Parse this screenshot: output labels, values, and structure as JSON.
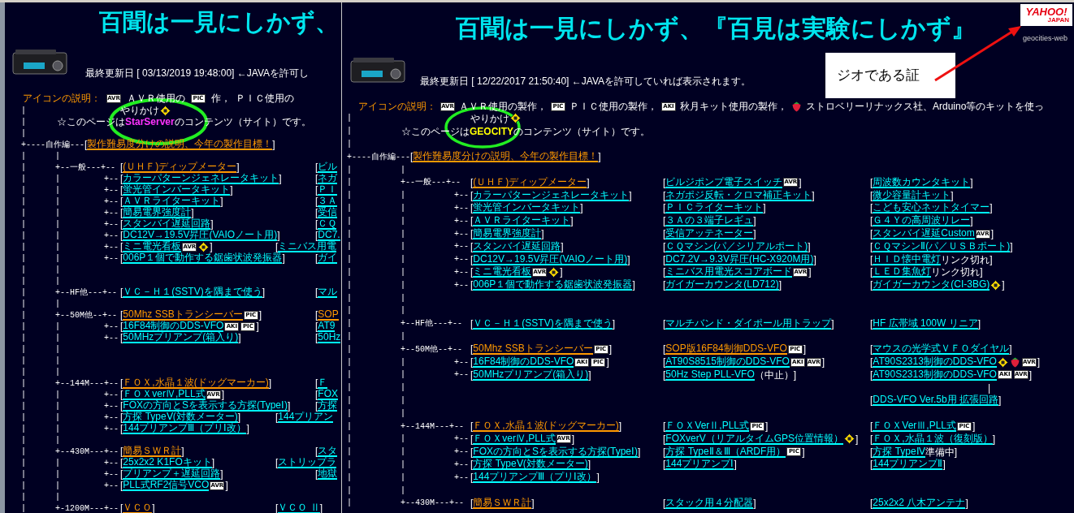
{
  "windows": [
    {
      "title": "百聞は一見にしかず、",
      "updated": "最終更新日 [ 03/13/2019 19:48:00] ←JAVAを許可し",
      "legend": [
        {
          "kind": "label",
          "text": "アイコンの説明："
        },
        {
          "kind": "chip",
          "text": "AVR"
        },
        {
          "kind": "text",
          "text": "ＡＶＲ使用の"
        },
        {
          "kind": "chip",
          "text": "PIC"
        },
        {
          "kind": "text",
          "text": "作，"
        },
        {
          "kind": "text",
          "text": "ＰＩＣ使用の"
        }
      ],
      "rows": [
        {
          "kind": "branch",
          "tree": "|",
          "cells": [
            {
              "text": "やりかけ",
              "icons": [
                {
                  "kind": "diamond"
                }
              ]
            }
          ]
        },
        {
          "kind": "note",
          "tree": "|",
          "text": "☆このページは**StarServer**のコンテンツ（サイト）です。",
          "color": "#ff33ff"
        },
        {
          "kind": "blank",
          "tree": "|"
        },
        {
          "kind": "section",
          "tree": "+----自作編---",
          "cells": [
            {
              "open": "[",
              "link": "製作難易度分けの説明、今年の製作目標！",
              "color": "#ff9900",
              "close": "]"
            }
          ]
        },
        {
          "kind": "blank",
          "tree": "|      |"
        },
        {
          "kind": "branch",
          "tree": "|      +--一般---+--",
          "cells": [
            {
              "open": "[",
              "link": "(ＵＨＦ)ディップメーター",
              "color": "#ff9900",
              "close": "]"
            },
            {
              "open": "[",
              "link": "ビル",
              "color": "#00ffff"
            }
          ]
        },
        {
          "kind": "branch",
          "tree": "|      |         +--",
          "cells": [
            {
              "open": "[",
              "link": "カラーパターンジェネレータキット",
              "color": "#00ffff",
              "close": "]"
            },
            {
              "open": "[",
              "link": "ネガ",
              "color": "#00ffff"
            }
          ]
        },
        {
          "kind": "branch",
          "tree": "|      |         +--",
          "cells": [
            {
              "open": "[",
              "link": "蛍光管インバータキット",
              "color": "#00ffff",
              "close": "]"
            },
            {
              "open": "[",
              "link": "ＰＩ",
              "color": "#00ffff"
            }
          ]
        },
        {
          "kind": "branch",
          "tree": "|      |         +--",
          "cells": [
            {
              "open": "[",
              "link": "ＡＶＲライターキット",
              "color": "#00ffff",
              "close": "]"
            },
            {
              "open": "[",
              "link": "３Ａ",
              "color": "#00ffff"
            }
          ]
        },
        {
          "kind": "branch",
          "tree": "|      |         +--",
          "cells": [
            {
              "open": "[",
              "link": "簡易電界強度計",
              "color": "#00ffff",
              "close": "]"
            },
            {
              "open": "[",
              "link": "受信",
              "color": "#00ffff"
            }
          ]
        },
        {
          "kind": "branch",
          "tree": "|      |         +--",
          "cells": [
            {
              "open": "[",
              "link": "スタンバイ遅延回路",
              "color": "#00ffff",
              "close": "]"
            },
            {
              "open": "[",
              "link": "ＣＱ",
              "color": "#00ffff"
            }
          ]
        },
        {
          "kind": "branch",
          "tree": "|      |         +--",
          "cells": [
            {
              "open": "[",
              "link": "DC12V→19.5V昇圧(VAIOノート用)",
              "color": "#00ffff",
              "close": "]"
            },
            {
              "open": "[",
              "link": "DC7.",
              "color": "#00ffff"
            }
          ]
        },
        {
          "kind": "loose",
          "tree": "|      |         +--",
          "cells": [
            {
              "open": "[",
              "link": "ミニ電光看板",
              "color": "#00ffff",
              "icons": [
                {
                  "kind": "chip",
                  "text": "AVR"
                },
                {
                  "kind": "diamond"
                }
              ],
              "close": "]"
            },
            {
              "open": "[",
              "link": "ミニバス用電",
              "color": "#00ffff"
            }
          ]
        },
        {
          "kind": "branch",
          "tree": "|      |         +--",
          "cells": [
            {
              "open": "[",
              "link": "006P１個で動作する鋸歯状波発振器",
              "color": "#00ffff",
              "close": "]"
            },
            {
              "open": "[",
              "link": "ガイ",
              "color": "#00ffff"
            }
          ]
        },
        {
          "kind": "blank",
          "tree": "|      |"
        },
        {
          "kind": "blank",
          "tree": "|      |"
        },
        {
          "kind": "branch",
          "tree": "|      +--HF他---+--",
          "cells": [
            {
              "open": "[",
              "link": "ＶＣ－Ｈ１(SSTV)を隅まで使う",
              "color": "#00ffff",
              "close": "]"
            },
            {
              "open": "[",
              "link": "マル",
              "color": "#00ffff"
            }
          ]
        },
        {
          "kind": "blank",
          "tree": "|      |"
        },
        {
          "kind": "branch",
          "tree": "|      +--50M他--+--",
          "cells": [
            {
              "open": "[",
              "link": "50Mhz SSBトランシーバー",
              "color": "#ff9900",
              "icons": [
                {
                  "kind": "chip",
                  "text": "PIC"
                }
              ],
              "close": "]"
            },
            {
              "open": "[",
              "link": "SOP",
              "color": "#ff9900"
            }
          ]
        },
        {
          "kind": "branch",
          "tree": "|      |         +--",
          "cells": [
            {
              "open": "[",
              "link": "16F84制御のDDS-VFO",
              "color": "#00ffff",
              "icons": [
                {
                  "kind": "chip",
                  "text": "AKI"
                },
                {
                  "kind": "chip",
                  "text": "PIC"
                }
              ],
              "close": "]"
            },
            {
              "open": "[",
              "link": "AT9",
              "color": "#00ffff"
            }
          ]
        },
        {
          "kind": "branch",
          "tree": "|      |         +--",
          "cells": [
            {
              "open": "[",
              "link": "50MHzプリアンプ(箱入り)",
              "color": "#00ffff",
              "close": "]"
            },
            {
              "open": "[",
              "link": "50Hz",
              "color": "#00ffff"
            }
          ]
        },
        {
          "kind": "blank",
          "tree": "|      |"
        },
        {
          "kind": "blank",
          "tree": "|      |"
        },
        {
          "kind": "blank",
          "tree": "|      |"
        },
        {
          "kind": "branch",
          "tree": "|      +--144M---+--",
          "cells": [
            {
              "open": "[",
              "link": "ＦＯＸ,水晶１波(ドッグマーカー)",
              "color": "#ff9900",
              "close": "]"
            },
            {
              "open": "[",
              "link": "Ｆ",
              "color": "#00ffff"
            }
          ]
        },
        {
          "kind": "branch",
          "tree": "|      |         +--",
          "cells": [
            {
              "open": "[",
              "link": "ＦＯＸverⅣ,PLL式",
              "color": "#00ffff",
              "icons": [
                {
                  "kind": "chip",
                  "text": "AVR"
                }
              ],
              "close": "]"
            },
            {
              "open": "[",
              "link": "FOX",
              "color": "#00ffff"
            }
          ]
        },
        {
          "kind": "branch",
          "tree": "|      |         +--",
          "cells": [
            {
              "open": "[",
              "link": "FOXの方向とSを表示する方探(TypeⅠ)",
              "color": "#00ffff",
              "close": "]"
            },
            {
              "open": "[",
              "link": "方探",
              "color": "#00ffff"
            }
          ]
        },
        {
          "kind": "loose",
          "tree": "|      |         +--",
          "cells": [
            {
              "open": "[",
              "link": "方探 TypeⅤ(対数メーター)",
              "color": "#00ffff",
              "close": "]"
            },
            {
              "open": "[",
              "link": "144プリアン",
              "color": "#00ffff"
            }
          ]
        },
        {
          "kind": "branch",
          "tree": "|      |         +--",
          "cells": [
            {
              "open": "[",
              "link": "144プリアンプⅢ（プリⅠ改）",
              "color": "#00ffff",
              "close": "]"
            }
          ]
        },
        {
          "kind": "blank",
          "tree": "|      |"
        },
        {
          "kind": "branch",
          "tree": "|      +--430M---+--",
          "cells": [
            {
              "open": "[",
              "link": "簡易ＳＷＲ計",
              "color": "#ff9900",
              "close": "]"
            },
            {
              "open": "[",
              "link": "スタ",
              "color": "#00ffff"
            }
          ]
        },
        {
          "kind": "loose",
          "tree": "|      |         +--",
          "cells": [
            {
              "open": "[",
              "link": "25x2x2 K1FOキット",
              "color": "#00ffff",
              "close": "]"
            },
            {
              "open": "[",
              "link": "ストリップラ",
              "color": "#00ffff"
            }
          ]
        },
        {
          "kind": "branch",
          "tree": "|      |         +--",
          "cells": [
            {
              "open": "[",
              "link": "プリアンプ＋遅延回路",
              "color": "#00ffff",
              "close": "]"
            },
            {
              "open": "[",
              "link": "地獄",
              "color": "#00ffff"
            }
          ]
        },
        {
          "kind": "branch",
          "tree": "|      |         +--",
          "cells": [
            {
              "open": "[",
              "link": "PLL式RF2信号VCO",
              "color": "#00ffff",
              "icons": [
                {
                  "kind": "chip",
                  "text": "AVR"
                }
              ],
              "close": "]"
            }
          ]
        },
        {
          "kind": "blank",
          "tree": "|      |"
        },
        {
          "kind": "loose",
          "tree": "|      +-1200M---+--",
          "cells": [
            {
              "open": "[",
              "link": "ＶＣＯ",
              "color": "#ff9900",
              "close": "]"
            },
            {
              "open": "[",
              "link": "ＶＣＯ Ⅱ",
              "color": "#00ffff",
              "close": "]"
            }
          ]
        }
      ]
    },
    {
      "title": "百聞は一見にしかず、『百見は実験にしかず』",
      "updated": "最終更新日 [ 12/22/2017 21:50:40] ←JAVAを許可していれば表示されます。",
      "logo": {
        "text": "YAHOO!",
        "subtext": "JAPAN",
        "caption": "geocities-web"
      },
      "callout": {
        "text": "ジオである証"
      },
      "legend": [
        {
          "kind": "label",
          "text": "アイコンの説明："
        },
        {
          "kind": "chip",
          "text": "AVR"
        },
        {
          "kind": "text",
          "text": "ＡＶＲ使用の製作，"
        },
        {
          "kind": "chip",
          "text": "PIC"
        },
        {
          "kind": "text",
          "text": "ＰＩＣ使用の製作，"
        },
        {
          "kind": "chip",
          "text": "AKI"
        },
        {
          "kind": "text",
          "text": "秋月キット使用の製作，"
        },
        {
          "kind": "strawberry"
        },
        {
          "kind": "text",
          "text": "ストロベリーリナックス社、Arduino等のキットを使っ"
        }
      ],
      "rows": [
        {
          "kind": "branch",
          "tree": "|",
          "cells": [
            {
              "text": "やりかけ",
              "icons": [
                {
                  "kind": "diamond"
                }
              ]
            }
          ]
        },
        {
          "kind": "note",
          "tree": "|",
          "text": "☆このページは**GEOCITY**のコンテンツ（サイト）です。",
          "color": "#ffff00"
        },
        {
          "kind": "blank",
          "tree": "|"
        },
        {
          "kind": "section",
          "tree": "+----自作編---",
          "cells": [
            {
              "open": "[",
              "link": "製作難易度分けの説明、今年の製作目標！",
              "color": "#ff9900",
              "close": "]"
            }
          ]
        },
        {
          "kind": "blank",
          "tree": "|          |"
        },
        {
          "kind": "branch",
          "tree": "|          +--一般---+--",
          "cells": [
            {
              "open": "[",
              "link": "(ＵＨＦ)ディップメーター",
              "color": "#ff9900",
              "close": "]"
            },
            {
              "open": "[",
              "link": "ビルジポンプ電子スイッチ",
              "color": "#00ffff",
              "icons": [
                {
                  "kind": "chip",
                  "text": "AVR"
                }
              ],
              "close": "]"
            },
            {
              "open": "[",
              "link": "周波数カウンタキット",
              "color": "#00ffff",
              "close": "]"
            }
          ]
        },
        {
          "kind": "branch",
          "tree": "|          |          +--",
          "cells": [
            {
              "open": "[",
              "link": "カラーパターンジェネレータキット",
              "color": "#00ffff",
              "close": "]"
            },
            {
              "open": "[",
              "link": "ネガポジ反転・クロマ補正キット",
              "color": "#00ffff",
              "close": "]"
            },
            {
              "open": "[",
              "link": "微少容量計キット",
              "color": "#00ffff",
              "close": "]"
            }
          ]
        },
        {
          "kind": "branch",
          "tree": "|          |          +--",
          "cells": [
            {
              "open": "[",
              "link": "蛍光管インバータキット",
              "color": "#00ffff",
              "close": "]"
            },
            {
              "open": "[",
              "link": "ＰＩＣライターキット",
              "color": "#00ffff",
              "close": "]"
            },
            {
              "open": "[",
              "link": "こども安心ネットタイマー",
              "color": "#00ffff",
              "close": "]"
            }
          ]
        },
        {
          "kind": "branch",
          "tree": "|          |          +--",
          "cells": [
            {
              "open": "[",
              "link": "ＡＶＲライターキット",
              "color": "#00ffff",
              "close": "]"
            },
            {
              "open": "[",
              "link": "３Ａの３端子レギュ",
              "color": "#00ffff",
              "close": "]"
            },
            {
              "open": "[",
              "link": "Ｇ４Ｙの高周波リレー",
              "color": "#00ffff",
              "close": "]"
            }
          ]
        },
        {
          "kind": "branch",
          "tree": "|          |          +--",
          "cells": [
            {
              "open": "[",
              "link": "簡易電界強度計",
              "color": "#00ffff",
              "close": "]"
            },
            {
              "open": "[",
              "link": "受信アッテネーター",
              "color": "#00ffff",
              "close": "]"
            },
            {
              "open": "[",
              "link": "スタンバイ遅延Custom",
              "color": "#00ffff",
              "icons": [
                {
                  "kind": "chip",
                  "text": "AVR"
                }
              ],
              "close": "]"
            }
          ]
        },
        {
          "kind": "branch",
          "tree": "|          |          +--",
          "cells": [
            {
              "open": "[",
              "link": "スタンバイ遅延回路",
              "color": "#00ffff",
              "close": "]"
            },
            {
              "open": "[",
              "link": "ＣＱマシン(パ／シリアルポート)",
              "color": "#00ffff",
              "close": "]"
            },
            {
              "open": "[",
              "link": "ＣＱマシンⅡ(パ／ＵＳＢポート)",
              "color": "#00ffff",
              "close": "]"
            }
          ]
        },
        {
          "kind": "branch",
          "tree": "|          |          +--",
          "cells": [
            {
              "open": "[",
              "link": "DC12V→19.5V昇圧(VAIOノート用)",
              "color": "#00ffff",
              "close": "]"
            },
            {
              "open": "[",
              "link": "DC7.2V→9.3V昇圧(HC-X920M用)",
              "color": "#00ffff",
              "close": "]"
            },
            {
              "open": "[",
              "link": "ＨＩＤ懐中電灯",
              "color": "#00ffff",
              "note": "リンク切れ",
              "close": "]"
            }
          ]
        },
        {
          "kind": "branch",
          "tree": "|          |          +--",
          "cells": [
            {
              "open": "[",
              "link": "ミニ電光看板",
              "color": "#00ffff",
              "icons": [
                {
                  "kind": "chip",
                  "text": "AVR"
                },
                {
                  "kind": "diamond"
                }
              ],
              "close": "]"
            },
            {
              "open": "[",
              "link": "ミニバス用電光スコアボード",
              "color": "#00ffff",
              "icons": [
                {
                  "kind": "chip",
                  "text": "AVR"
                }
              ],
              "close": "]"
            },
            {
              "open": "[",
              "link": "ＬＥＤ集魚灯",
              "color": "#00ffff",
              "note": "リンク切れ",
              "close": "]"
            }
          ]
        },
        {
          "kind": "branch",
          "tree": "|          |          +--",
          "cells": [
            {
              "open": "[",
              "link": "006P１個で動作する鋸歯状波発振器",
              "color": "#00ffff",
              "close": "]"
            },
            {
              "open": "[",
              "link": "ガイガーカウンタ(LD712)",
              "color": "#00ffff",
              "close": "]"
            },
            {
              "open": "[",
              "link": "ガイガーカウンタ(CI-3BG)",
              "color": "#00ffff",
              "icons": [
                {
                  "kind": "diamond"
                }
              ],
              "close": "]"
            }
          ]
        },
        {
          "kind": "blank",
          "tree": "|          |"
        },
        {
          "kind": "blank",
          "tree": "|          |"
        },
        {
          "kind": "branch",
          "tree": "|          +--HF他---+--",
          "cells": [
            {
              "open": "[",
              "link": "ＶＣ－Ｈ１(SSTV)を隅まで使う",
              "color": "#00ffff",
              "close": "]"
            },
            {
              "open": "[",
              "link": "マルチバンド・ダイポール用トラップ",
              "color": "#00ffff",
              "close": "]"
            },
            {
              "open": "[",
              "link": "HF 広帯域 100W リニア",
              "color": "#00ffff",
              "close": "]"
            }
          ]
        },
        {
          "kind": "blank",
          "tree": "|          |"
        },
        {
          "kind": "branch",
          "tree": "|          +--50M他--+--",
          "cells": [
            {
              "open": "[",
              "link": "50Mhz SSBトランシーバー",
              "color": "#ff9900",
              "icons": [
                {
                  "kind": "chip",
                  "text": "PIC"
                }
              ],
              "close": "]"
            },
            {
              "open": "[",
              "link": "SOP版16F84制御DDS-VFO",
              "color": "#ff9900",
              "icons": [
                {
                  "kind": "chip",
                  "text": "PIC"
                }
              ],
              "close": "]"
            },
            {
              "open": "[",
              "link": "マウスの光学式ＶＦＯダイヤル",
              "color": "#00ffff",
              "close": "]"
            }
          ]
        },
        {
          "kind": "branch",
          "tree": "|          |          +--",
          "cells": [
            {
              "open": "[",
              "link": "16F84制御のDDS-VFO",
              "color": "#00ffff",
              "icons": [
                {
                  "kind": "chip",
                  "text": "AKI"
                },
                {
                  "kind": "chip",
                  "text": "PIC"
                }
              ],
              "close": "]"
            },
            {
              "open": "[",
              "link": "AT90S8515制御のDDS-VFO",
              "color": "#00ffff",
              "icons": [
                {
                  "kind": "chip",
                  "text": "AKI"
                },
                {
                  "kind": "chip",
                  "text": "AVR"
                }
              ],
              "close": "]"
            },
            {
              "open": "[",
              "link": "AT90S2313制御のDDS-VFO",
              "color": "#00ffff",
              "icons": [
                {
                  "kind": "diamond"
                },
                {
                  "kind": "strawberry"
                },
                {
                  "kind": "chip",
                  "text": "AVR"
                }
              ],
              "close": "]"
            }
          ]
        },
        {
          "kind": "branch",
          "tree": "|          |          +--",
          "cells": [
            {
              "open": "[",
              "link": "50MHzプリアンプ(箱入り)",
              "color": "#00ffff",
              "close": "]"
            },
            {
              "open": "[",
              "link": "50Hz Step PLL-VFO",
              "color": "#00ffff",
              "note": "（中止）",
              "close": "]"
            },
            {
              "open": "[",
              "link": "AT90S2313制御のDDS-VFO",
              "color": "#00ffff",
              "icons": [
                {
                  "kind": "chip",
                  "text": "AKI"
                },
                {
                  "kind": "chip",
                  "text": "AVR"
                }
              ],
              "close": "]"
            }
          ]
        },
        {
          "kind": "blank",
          "tree": "|          |",
          "cells": [
            null,
            null,
            {
              "kind": "stem",
              "text": "|"
            }
          ]
        },
        {
          "kind": "branch",
          "tree": "|          |",
          "cells": [
            null,
            null,
            {
              "open": "[",
              "link": "DDS-VFO Ver.5b用 拡張回路",
              "color": "#00ffff",
              "close": "]"
            }
          ]
        },
        {
          "kind": "blank",
          "tree": "|          |"
        },
        {
          "kind": "branch",
          "tree": "|          +--144M---+--",
          "cells": [
            {
              "open": "[",
              "link": "ＦＯＸ,水晶１波(ドッグマーカー)",
              "color": "#ff9900",
              "close": "]"
            },
            {
              "open": "[",
              "link": "ＦＯＸVerⅡ,PLL式",
              "color": "#00ffff",
              "icons": [
                {
                  "kind": "chip",
                  "text": "PIC"
                }
              ],
              "close": "]"
            },
            {
              "open": "[",
              "link": "ＦＯＸVerⅢ,PLL式",
              "color": "#00ffff",
              "icons": [
                {
                  "kind": "chip",
                  "text": "PIC"
                }
              ],
              "close": "]"
            }
          ]
        },
        {
          "kind": "branch",
          "tree": "|          |          +--",
          "cells": [
            {
              "open": "[",
              "link": "ＦＯＸverⅣ,PLL式",
              "color": "#00ffff",
              "icons": [
                {
                  "kind": "chip",
                  "text": "AVR"
                }
              ],
              "close": "]"
            },
            {
              "open": "[",
              "link": "FOXverV（リアルタイムGPS位置情報）",
              "color": "#00ffff",
              "icons": [
                {
                  "kind": "diamond"
                }
              ],
              "close": "]"
            },
            {
              "open": "[",
              "link": "ＦＯＸ,水晶１波（復刻版）",
              "color": "#00ffff",
              "close": "]"
            }
          ]
        },
        {
          "kind": "branch",
          "tree": "|          |          +--",
          "cells": [
            {
              "open": "[",
              "link": "FOXの方向とSを表示する方探(TypeⅠ)",
              "color": "#00ffff",
              "close": "]"
            },
            {
              "open": "[",
              "link": "方探 TypeⅡ＆Ⅲ（ARDF用）",
              "color": "#00ffff",
              "icons": [
                {
                  "kind": "chip",
                  "text": "PIC"
                }
              ],
              "close": "]"
            },
            {
              "open": "[",
              "link": "方探 TypeⅣ",
              "color": "#00ffff",
              "note": "準備中",
              "close": "]"
            }
          ]
        },
        {
          "kind": "branch",
          "tree": "|          |          +--",
          "cells": [
            {
              "open": "[",
              "link": "方探 TypeⅤ(対数メーター)",
              "color": "#00ffff",
              "close": "]"
            },
            {
              "open": "[",
              "link": "144プリアンプⅠ",
              "color": "#00ffff",
              "close": "]"
            },
            {
              "open": "[",
              "link": "144プリアンプⅡ",
              "color": "#00ffff",
              "close": "]"
            }
          ]
        },
        {
          "kind": "branch",
          "tree": "|          |          +--",
          "cells": [
            {
              "open": "[",
              "link": "144プリアンプⅢ（プリⅠ改）",
              "color": "#00ffff",
              "close": "]"
            }
          ]
        },
        {
          "kind": "blank",
          "tree": "|          |"
        },
        {
          "kind": "branch",
          "tree": "|          +--430M---+--",
          "cells": [
            {
              "open": "[",
              "link": "簡易ＳＷＲ計",
              "color": "#ff9900",
              "close": "]"
            },
            {
              "open": "[",
              "link": "スタック用４分配器",
              "color": "#00ffff",
              "close": "]"
            },
            {
              "open": "[",
              "link": "25x2x2 八木アンテナ",
              "color": "#00ffff",
              "close": "]"
            }
          ]
        }
      ]
    }
  ]
}
